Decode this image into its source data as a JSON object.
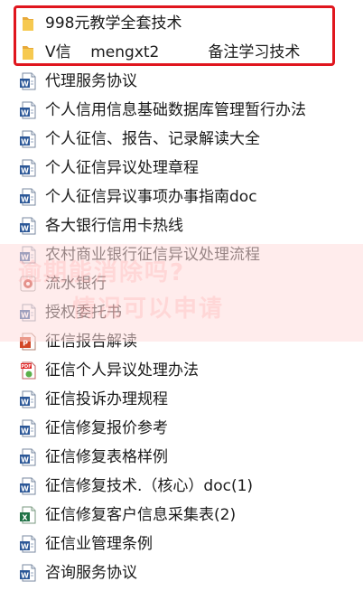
{
  "files": [
    {
      "name": "998元教学全套技术",
      "type": "folder-icon"
    },
    {
      "name": "V信    mengxt2          备注学习技术",
      "type": "folder-icon"
    },
    {
      "name": "代理服务协议",
      "type": "word-icon"
    },
    {
      "name": "个人信用信息基础数据库管理暂行办法",
      "type": "word-icon"
    },
    {
      "name": "个人征信、报告、记录解读大全",
      "type": "word-icon"
    },
    {
      "name": "个人征信异议处理章程",
      "type": "word-icon"
    },
    {
      "name": "个人征信异议事项办事指南doc",
      "type": "word-icon"
    },
    {
      "name": "各大银行信用卡热线",
      "type": "word-icon"
    },
    {
      "name": "农村商业银行征信异议处理流程",
      "type": "word-icon"
    },
    {
      "name": "流水银行",
      "type": "media-icon"
    },
    {
      "name": "授权委托书",
      "type": "word-icon"
    },
    {
      "name": "征信报告解读",
      "type": "ppt-icon"
    },
    {
      "name": "征信个人异议处理办法",
      "type": "pdf-icon"
    },
    {
      "name": "征信投诉办理规程",
      "type": "word-icon"
    },
    {
      "name": "征信修复报价参考",
      "type": "word-icon"
    },
    {
      "name": "征信修复表格样例",
      "type": "word-icon"
    },
    {
      "name": "征信修复技术.（核心）doc(1)",
      "type": "word-icon"
    },
    {
      "name": "征信修复客户信息采集表(2)",
      "type": "excel-icon"
    },
    {
      "name": "征信业管理条例",
      "type": "word-icon"
    },
    {
      "name": "咨询服务协议",
      "type": "word-icon"
    }
  ],
  "watermark": [
    "逾期能消除吗?",
    "情况可以申请"
  ],
  "colors": {
    "highlight": "#e0161e",
    "folder": "#f2c14e",
    "word": "#2b5797",
    "excel": "#1e7145",
    "ppt": "#d24726",
    "pdf": "#e02020"
  }
}
